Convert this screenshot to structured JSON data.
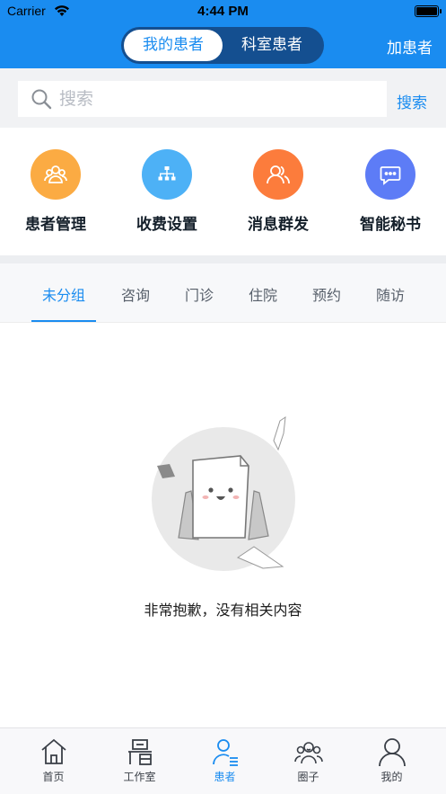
{
  "status_bar": {
    "carrier": "Carrier",
    "time": "4:44 PM"
  },
  "nav": {
    "segments": [
      "我的患者",
      "科室患者"
    ],
    "active_segment": "我的患者",
    "add_patient": "加患者"
  },
  "search": {
    "placeholder": "搜索",
    "button": "搜索"
  },
  "quick_actions": [
    {
      "label": "患者管理",
      "icon": "patients-group-icon",
      "color": "#fbab43"
    },
    {
      "label": "收费设置",
      "icon": "org-chart-icon",
      "color": "#4db1f6"
    },
    {
      "label": "消息群发",
      "icon": "users-broadcast-icon",
      "color": "#fc7c3c"
    },
    {
      "label": "智能秘书",
      "icon": "chat-bubble-icon",
      "color": "#5d7cf6"
    }
  ],
  "tabs": [
    "未分组",
    "咨询",
    "门诊",
    "住院",
    "预约",
    "随访"
  ],
  "active_tab": "未分组",
  "empty_state": {
    "message": "非常抱歉，没有相关内容"
  },
  "tab_bar": [
    {
      "label": "首页",
      "icon": "home-icon"
    },
    {
      "label": "工作室",
      "icon": "workstation-icon"
    },
    {
      "label": "患者",
      "icon": "patient-icon"
    },
    {
      "label": "圈子",
      "icon": "circle-group-icon"
    },
    {
      "label": "我的",
      "icon": "profile-icon"
    }
  ],
  "active_tab_bar": "患者",
  "colors": {
    "primary": "#1a8cf0",
    "segment_bg": "#144f90"
  }
}
